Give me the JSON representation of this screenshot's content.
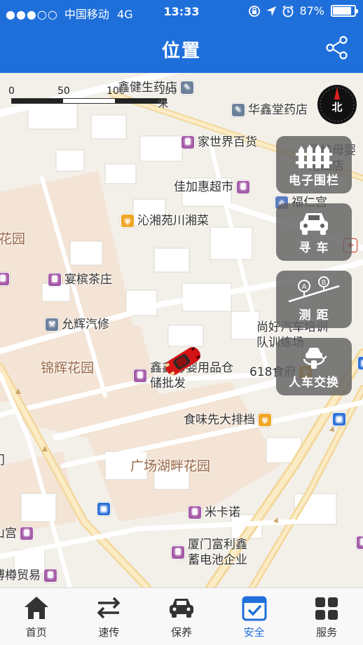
{
  "status_bar": {
    "carrier": "中国移动",
    "network": "4G",
    "time": "13:33",
    "battery_text": "87%",
    "battery_level": 0.87
  },
  "header": {
    "title": "位置",
    "share_icon": "share-icon"
  },
  "map": {
    "scale": {
      "labels": [
        "0",
        "50",
        "100",
        "150米"
      ]
    },
    "compass_label": "北",
    "pois": [
      {
        "name": "鑫健生药店",
        "icon": "pharmacy-icon"
      },
      {
        "name": "华鑫堂药店",
        "icon": "pharmacy-icon"
      },
      {
        "name": "家世界百货",
        "icon": "shopping-icon"
      },
      {
        "name": "贝坊母婴用品店",
        "icon": "shopping-icon"
      },
      {
        "name": "佳加惠超市",
        "icon": "shopping-icon"
      },
      {
        "name": "福仁宫",
        "icon": "temple-icon"
      },
      {
        "name": "沁湘苑川湘菜",
        "icon": "food-icon"
      },
      {
        "name": "花园",
        "icon": ""
      },
      {
        "name": "宴槟茶庄",
        "icon": "shopping-icon"
      },
      {
        "name": "允辉汽修",
        "icon": "car-repair-icon"
      },
      {
        "name": "尚好汽车培训队训练场",
        "icon": ""
      },
      {
        "name": "锦辉花园",
        "icon": ""
      },
      {
        "name": "鑫鑫母婴用品仓储批发",
        "icon": "shopping-icon"
      },
      {
        "name": "618食府",
        "icon": "food-icon"
      },
      {
        "name": "食味先大排档",
        "icon": "food-icon"
      },
      {
        "name": "广场湖畔花园",
        "icon": ""
      },
      {
        "name": "米卡诺",
        "icon": "shopping-icon"
      },
      {
        "name": "厦门富利鑫蓄电池企业",
        "icon": "shopping-icon"
      },
      {
        "name": "山宫",
        "icon": "shopping-icon"
      },
      {
        "name": "博樽贸易",
        "icon": "shopping-icon"
      },
      {
        "name": "门",
        "icon": ""
      }
    ],
    "tools": [
      {
        "label": "电子围栏",
        "icon": "fence-icon"
      },
      {
        "label": "寻 车",
        "icon": "find-car-icon"
      },
      {
        "label": "测 距",
        "icon": "distance-icon"
      },
      {
        "label": "人车交换",
        "icon": "person-car-swap-icon"
      }
    ]
  },
  "tabbar": {
    "items": [
      {
        "label": "首页",
        "icon": "home-icon",
        "active": false
      },
      {
        "label": "速传",
        "icon": "transfer-icon",
        "active": false
      },
      {
        "label": "保养",
        "icon": "car-icon",
        "active": false
      },
      {
        "label": "安全",
        "icon": "security-icon",
        "active": true
      },
      {
        "label": "服务",
        "icon": "grid-icon",
        "active": false
      }
    ]
  },
  "colors": {
    "header": "#1f6fdb",
    "active_tab": "#1f6fdb",
    "tab_inactive": "#333333",
    "tool_button_bg": "#606060"
  }
}
